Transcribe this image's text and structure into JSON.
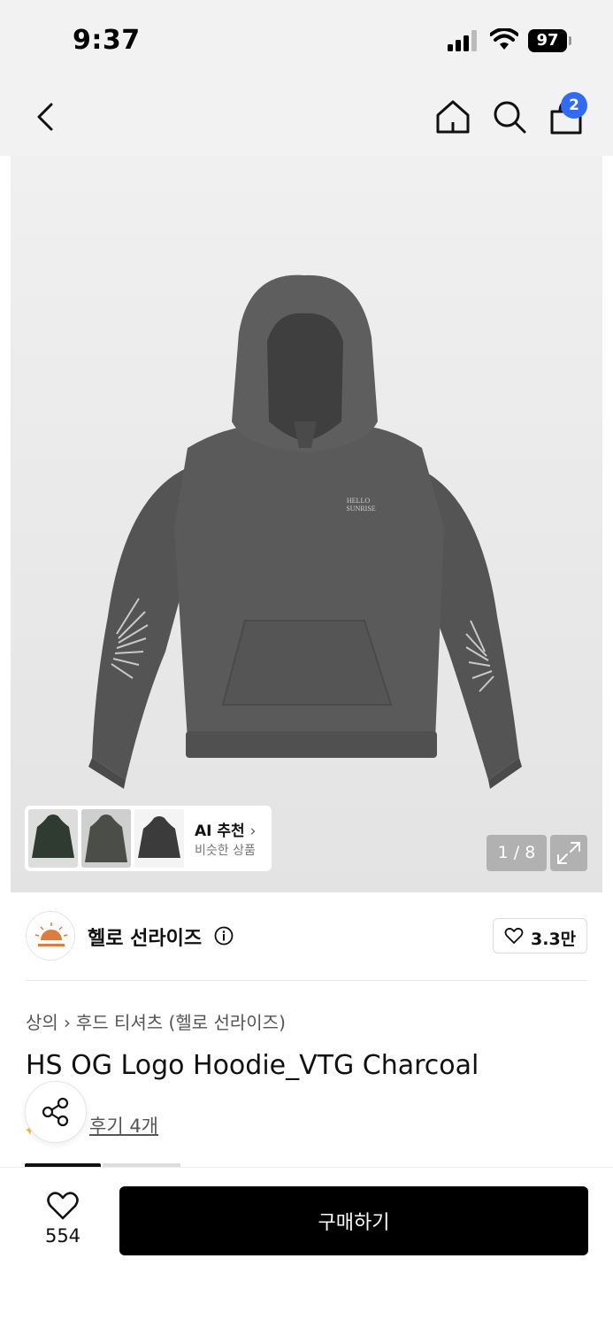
{
  "status_bar": {
    "time": "9:37",
    "battery": "97"
  },
  "nav": {
    "cart_count": "2"
  },
  "gallery": {
    "ai_title": "AI 추천",
    "ai_subtitle": "비슷한 상품",
    "page_indicator": "1 / 8"
  },
  "brand": {
    "name": "헬로 선라이즈",
    "follow_count": "3.3만"
  },
  "breadcrumb": {
    "category": "상의",
    "sub_category": "후드 티셔츠 (헬로 선라이즈)"
  },
  "product": {
    "title": "HS OG Logo Hoodie_VTG Charcoal",
    "review_label": "후기 4개"
  },
  "bottom_bar": {
    "like_count": "554",
    "buy_label": "구매하기"
  },
  "colors": {
    "accent": "#2f6cf6",
    "buy_button": "#000000",
    "hoodie": "#5a5a5a"
  },
  "icons": [
    "back-icon",
    "home-icon",
    "search-icon",
    "cart-icon",
    "expand-icon",
    "info-icon",
    "heart-icon",
    "share-icon"
  ]
}
